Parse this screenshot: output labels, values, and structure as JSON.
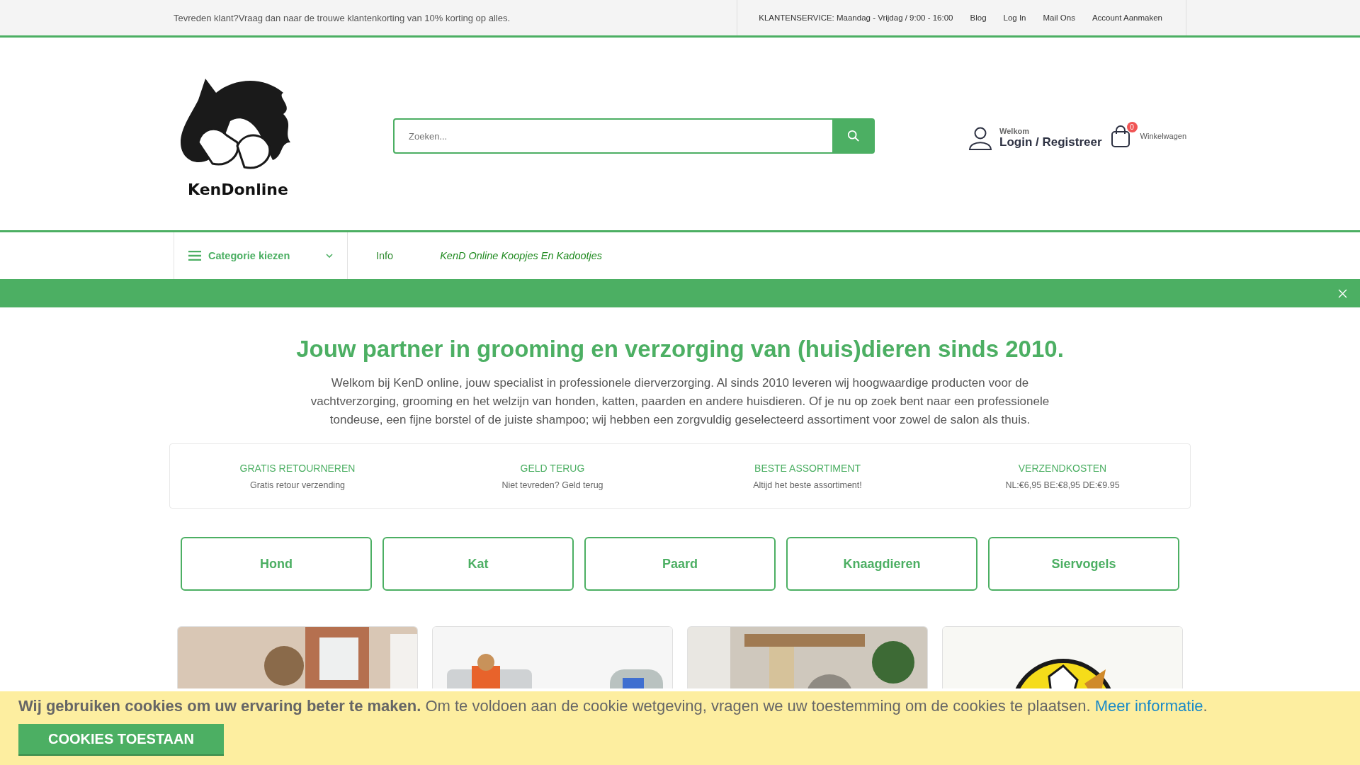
{
  "top_bar": {
    "promo": "Tevreden klant?Vraag dan naar de trouwe klantenkorting van 10% korting op alles.",
    "service": "KLANTENSERVICE: Maandag - Vrijdag / 9:00 - 16:00",
    "links": [
      "Blog",
      "Log In",
      "Mail Ons",
      "Account Aanmaken"
    ]
  },
  "header": {
    "logo_text": "KenDonline",
    "search": {
      "placeholder": "Zoeken..."
    },
    "account": {
      "welcome": "Welkom",
      "login": "Login / Registreer"
    },
    "cart": {
      "count": "0",
      "label": "Winkelwagen"
    }
  },
  "nav": {
    "category_menu": "Categorie kiezen",
    "links": [
      {
        "label": "Info",
        "kind": "plain"
      },
      {
        "label": "KenD Online Koopjes En Kadootjes",
        "kind": "promo"
      }
    ]
  },
  "intro": {
    "heading": "Jouw partner in grooming en verzorging van (huis)dieren sinds 2010.",
    "text": "Welkom bij KenD online, jouw specialist in professionele dierverzorging. Al sinds 2010 leveren wij hoogwaardige producten voor de vachtverzorging, grooming en het welzijn van honden, katten, paarden en andere huisdieren. Of je nu op zoek bent naar een professionele tondeuse, een fijne borstel of de juiste shampoo; wij hebben een zorgvuldig geselecteerd assortiment voor zowel de salon als thuis."
  },
  "features": [
    {
      "title": "GRATIS RETOURNEREN",
      "text": "Gratis retour verzending"
    },
    {
      "title": "GELD TERUG",
      "text": "Niet tevreden? Geld terug"
    },
    {
      "title": "BESTE ASSORTIMENT",
      "text": "Altijd het beste assortiment!"
    },
    {
      "title": "VERZENDKOSTEN",
      "text": "NL:€6,95 BE:€8,95 DE:€9.95"
    }
  ],
  "categories": [
    "Hond",
    "Kat",
    "Paard",
    "Knaagdieren",
    "Siervogels"
  ],
  "cookie": {
    "text": "**Wij gebruiken cookies om uw ervaring beter te maken.** Om te voldoen aan de cookie wetgeving, vragen we uw toestemming om de cookies te plaatsen.",
    "link": "Meer informatie",
    "after": ".",
    "button": "COOKIES TOESTAAN"
  }
}
